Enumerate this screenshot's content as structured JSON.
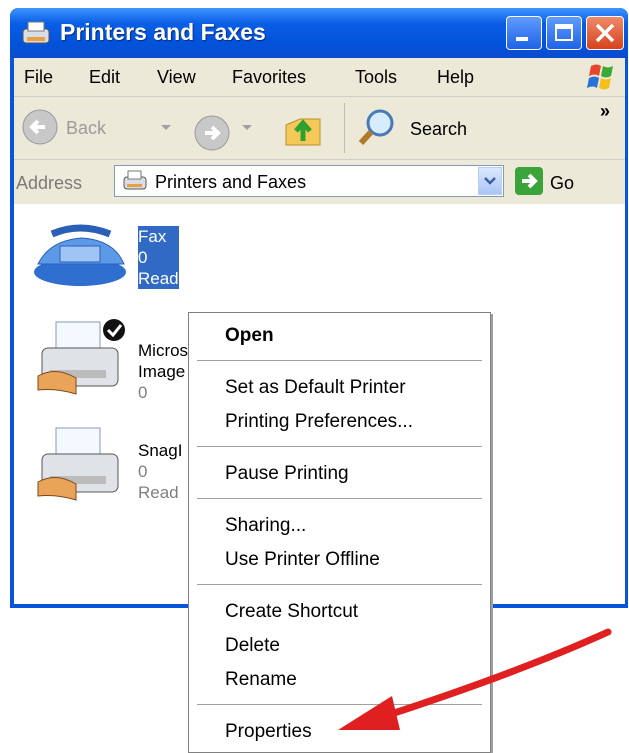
{
  "window": {
    "title": "Printers and Faxes"
  },
  "menubar": {
    "items": [
      "File",
      "Edit",
      "View",
      "Favorites",
      "Tools",
      "Help"
    ]
  },
  "toolbar": {
    "back_label": "Back",
    "search_label": "Search",
    "overflow": "»"
  },
  "address": {
    "label": "Address",
    "value": "Printers and Faxes",
    "go_label": "Go"
  },
  "items": [
    {
      "name": "Fax",
      "line2": "0",
      "line3": "Read",
      "icon": "fax-icon",
      "selected": true
    },
    {
      "name": "Micros",
      "line2": "Image",
      "line3": "0",
      "icon": "printer-icon",
      "default": true
    },
    {
      "name": "SnagI",
      "line2": "0",
      "line3": "Read",
      "icon": "printer-icon"
    }
  ],
  "context_menu": {
    "open": "Open",
    "set_default": "Set as Default Printer",
    "preferences": "Printing Preferences...",
    "pause": "Pause Printing",
    "sharing": "Sharing...",
    "offline": "Use Printer Offline",
    "shortcut": "Create Shortcut",
    "delete": "Delete",
    "rename": "Rename",
    "properties": "Properties"
  },
  "colors": {
    "titlebar": "#0a5fe6",
    "selection": "#316ac5",
    "annotation_arrow": "#e02020",
    "chrome": "#ece9d8"
  }
}
